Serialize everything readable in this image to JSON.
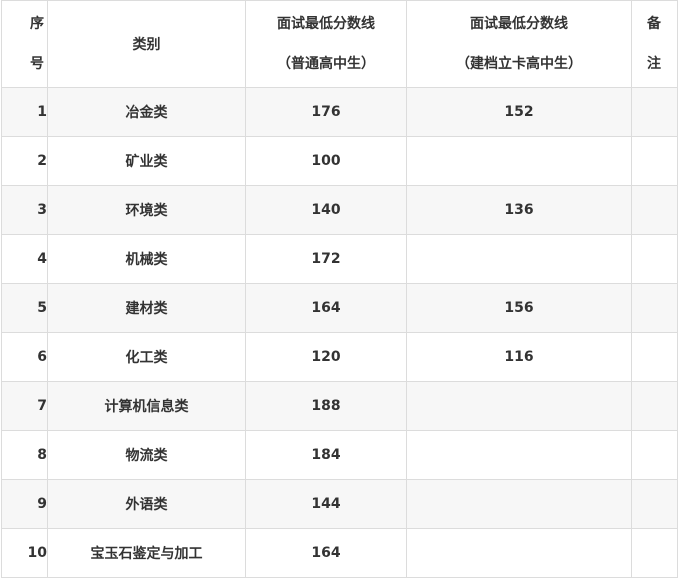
{
  "header": {
    "no_line1": "序",
    "no_line2": "号",
    "category": "类别",
    "score1_line1": "面试最低分数线",
    "score1_line2": "（普通高中生）",
    "score2_line1": "面试最低分数线",
    "score2_line2": "（建档立卡高中生）",
    "remark_line1": "备",
    "remark_line2": "注"
  },
  "rows": [
    {
      "no": "1",
      "category": "冶金类",
      "score_regular": "176",
      "score_poor": "152",
      "remark": ""
    },
    {
      "no": "2",
      "category": "矿业类",
      "score_regular": "100",
      "score_poor": "",
      "remark": ""
    },
    {
      "no": "3",
      "category": "环境类",
      "score_regular": "140",
      "score_poor": "136",
      "remark": ""
    },
    {
      "no": "4",
      "category": "机械类",
      "score_regular": "172",
      "score_poor": "",
      "remark": ""
    },
    {
      "no": "5",
      "category": "建材类",
      "score_regular": "164",
      "score_poor": "156",
      "remark": ""
    },
    {
      "no": "6",
      "category": "化工类",
      "score_regular": "120",
      "score_poor": "116",
      "remark": ""
    },
    {
      "no": "7",
      "category": "计算机信息类",
      "score_regular": "188",
      "score_poor": "",
      "remark": ""
    },
    {
      "no": "8",
      "category": "物流类",
      "score_regular": "184",
      "score_poor": "",
      "remark": ""
    },
    {
      "no": "9",
      "category": "外语类",
      "score_regular": "144",
      "score_poor": "",
      "remark": ""
    },
    {
      "no": "10",
      "category": "宝玉石鉴定与加工",
      "score_regular": "164",
      "score_poor": "",
      "remark": ""
    }
  ]
}
